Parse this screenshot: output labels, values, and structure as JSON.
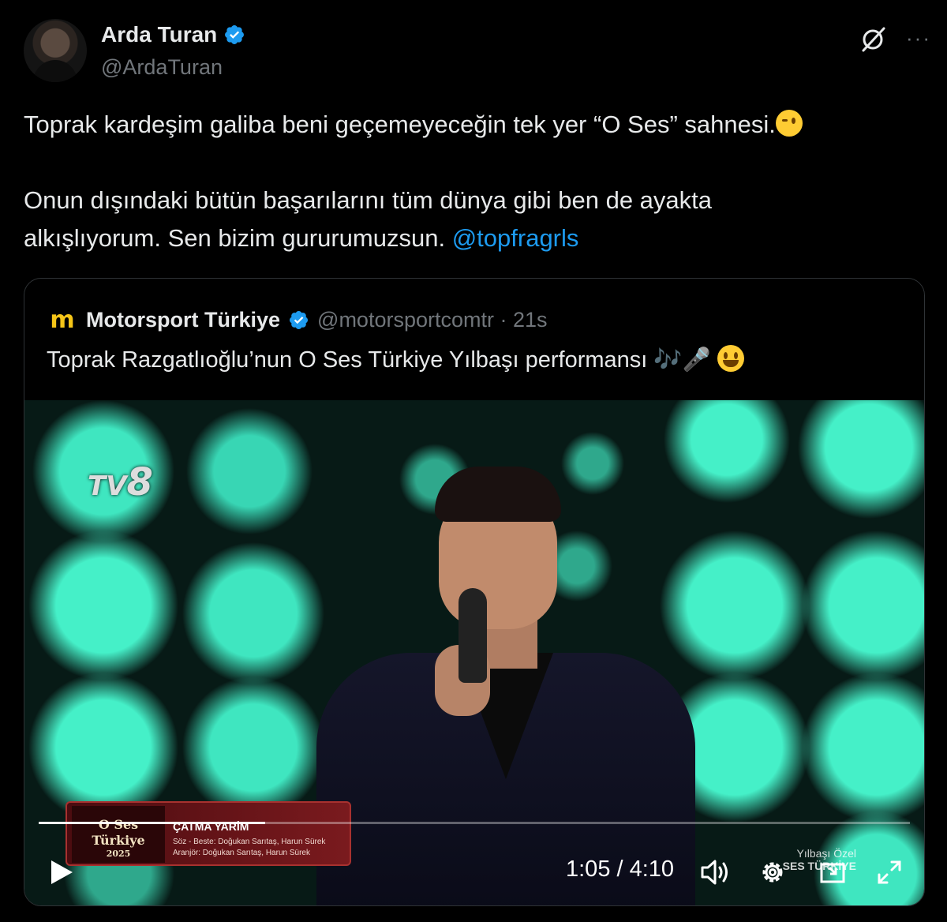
{
  "author": {
    "name": "Arda Turan",
    "handle": "@ArdaTuran",
    "verified_icon": "verified-badge-icon"
  },
  "header_actions": {
    "grok_icon": "grok-icon",
    "more_icon": "more-icon",
    "more_glyph": "···"
  },
  "tweet": {
    "line1": "Toprak kardeşim galiba beni geçemeyeceğin tek yer “O Ses” sahnesi.",
    "line2": "Onun dışındaki bütün başarılarını tüm dünya gibi ben de ayakta",
    "line3": "alkışlıyorum. Sen bizim gururumuzsun. ",
    "mention": "@topfragrls"
  },
  "quote": {
    "logo_glyph": "m",
    "name": "Motorsport Türkiye",
    "handle": "@motorsportcomtr · 21s",
    "text": "Toprak Razgatlıoğlu’nun O Ses Türkiye Yılbaşı performansı 🎶🎤"
  },
  "video": {
    "channel_logo_text": "TV",
    "channel_logo_num": "8",
    "lower_third": {
      "logo_line1": "O Ses",
      "logo_line2": "Türkiye",
      "logo_line3": "2025",
      "song_title": "ÇATMA YARİM",
      "credit1": "Söz - Beste: Doğukan Sarıtaş, Harun Sürek",
      "credit2": "Aranjör: Doğukan Sarıtaş, Harun Sürek"
    },
    "watermark_line1": "Yılbaşı Özel",
    "watermark_line2": "SES TÜRKİYE",
    "time_display": "1:05 / 4:10",
    "progress_fraction": 0.26
  }
}
